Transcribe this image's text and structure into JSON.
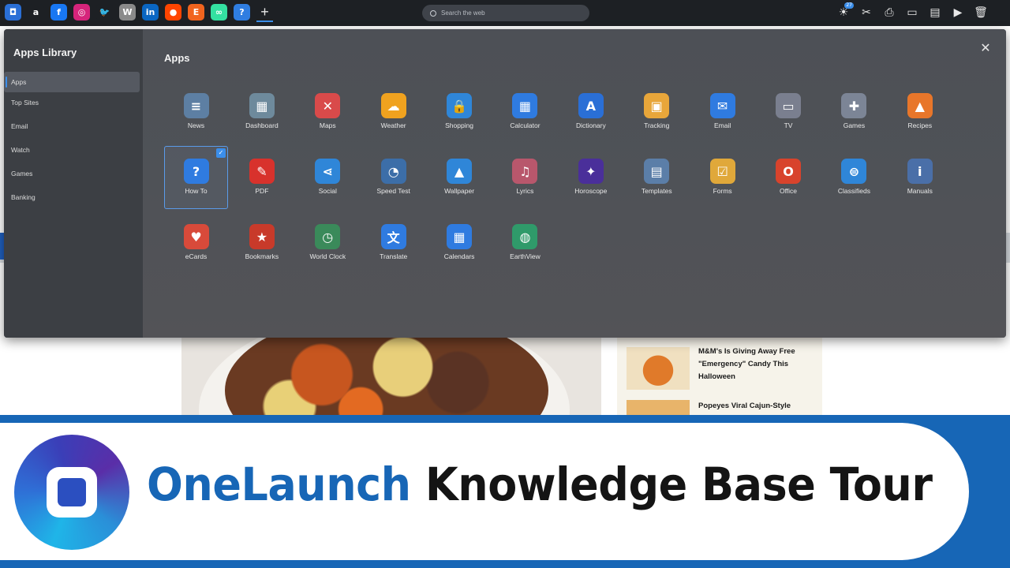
{
  "taskbar": {
    "favicons": [
      {
        "icon": "onelaunch-icon",
        "glyph": "◘",
        "color": "#2a6fd6"
      },
      {
        "icon": "amazon-icon",
        "glyph": "a",
        "color": "#1d2024"
      },
      {
        "icon": "facebook-icon",
        "glyph": "f",
        "color": "#1877f2"
      },
      {
        "icon": "instagram-icon",
        "glyph": "◎",
        "color": "#d6247b"
      },
      {
        "icon": "twitter-icon",
        "glyph": "🐦",
        "color": "#1d2024"
      },
      {
        "icon": "wikipedia-icon",
        "glyph": "W",
        "color": "#8a8a8a"
      },
      {
        "icon": "linkedin-icon",
        "glyph": "in",
        "color": "#0a66c2"
      },
      {
        "icon": "reddit-icon",
        "glyph": "●",
        "color": "#ff4500"
      },
      {
        "icon": "etsy-icon",
        "glyph": "E",
        "color": "#f1641e"
      },
      {
        "icon": "tripadvisor-icon",
        "glyph": "∞",
        "color": "#34e0a1"
      },
      {
        "icon": "help-icon",
        "glyph": "?",
        "color": "#2f7de1"
      }
    ],
    "new_tab": "+",
    "search_placeholder": "Search the web",
    "right_tools": [
      {
        "icon": "extensions-icon",
        "glyph": "☀",
        "badge": "27"
      },
      {
        "icon": "snip-icon",
        "glyph": "✂"
      },
      {
        "icon": "print-icon",
        "glyph": "⎙"
      },
      {
        "icon": "record-icon",
        "glyph": "▭"
      },
      {
        "icon": "notes-icon",
        "glyph": "▤"
      },
      {
        "icon": "play-icon",
        "glyph": "▶"
      },
      {
        "icon": "trash-icon",
        "glyph": "🗑"
      }
    ]
  },
  "background_page": {
    "news": [
      "M&M's Is Giving Away Free \"Emergency\" Candy This Halloween",
      "Popeyes Viral Cajun-Style"
    ]
  },
  "library": {
    "title": "Apps Library",
    "sidebar": [
      "Apps",
      "Top Sites",
      "Email",
      "Watch",
      "Games",
      "Banking"
    ],
    "active_index": 0,
    "section_title": "Apps",
    "close_glyph": "✕",
    "selected_app": "How To",
    "apps": [
      {
        "label": "News",
        "icon": "news-icon",
        "glyph": "≡",
        "color": "#5d7fa3"
      },
      {
        "label": "Dashboard",
        "icon": "dashboard-icon",
        "glyph": "▦",
        "color": "#6e8a9c"
      },
      {
        "label": "Maps",
        "icon": "maps-icon",
        "glyph": "✕",
        "color": "#d94a4a"
      },
      {
        "label": "Weather",
        "icon": "weather-icon",
        "glyph": "☁",
        "color": "#f0a21f"
      },
      {
        "label": "Shopping",
        "icon": "shopping-icon",
        "glyph": "🔒",
        "color": "#2f86d8"
      },
      {
        "label": "Calculator",
        "icon": "calculator-icon",
        "glyph": "▦",
        "color": "#2f7be0"
      },
      {
        "label": "Dictionary",
        "icon": "dictionary-icon",
        "glyph": "A",
        "color": "#2a6fd6"
      },
      {
        "label": "Tracking",
        "icon": "tracking-icon",
        "glyph": "▣",
        "color": "#e8a63a"
      },
      {
        "label": "Email",
        "icon": "email-icon",
        "glyph": "✉",
        "color": "#2f7be0"
      },
      {
        "label": "TV",
        "icon": "tv-icon",
        "glyph": "▭",
        "color": "#7a7f8f"
      },
      {
        "label": "Games",
        "icon": "games-icon",
        "glyph": "✚",
        "color": "#7c8596"
      },
      {
        "label": "Recipes",
        "icon": "recipes-icon",
        "glyph": "▲",
        "color": "#e8762a"
      },
      {
        "label": "How To",
        "icon": "how-to-icon",
        "glyph": "?",
        "color": "#2f7be0"
      },
      {
        "label": "PDF",
        "icon": "pdf-icon",
        "glyph": "✎",
        "color": "#d8322c"
      },
      {
        "label": "Social",
        "icon": "social-icon",
        "glyph": "⋖",
        "color": "#2f86d8"
      },
      {
        "label": "Speed Test",
        "icon": "speed-test-icon",
        "glyph": "◔",
        "color": "#3c6ea8"
      },
      {
        "label": "Wallpaper",
        "icon": "wallpaper-icon",
        "glyph": "▲",
        "color": "#2f86d8"
      },
      {
        "label": "Lyrics",
        "icon": "lyrics-icon",
        "glyph": "♫",
        "color": "#b8576c"
      },
      {
        "label": "Horoscope",
        "icon": "horoscope-icon",
        "glyph": "✦",
        "color": "#4a2f9a"
      },
      {
        "label": "Templates",
        "icon": "templates-icon",
        "glyph": "▤",
        "color": "#5b7ea8"
      },
      {
        "label": "Forms",
        "icon": "forms-icon",
        "glyph": "☑",
        "color": "#e0a83a"
      },
      {
        "label": "Office",
        "icon": "office-icon",
        "glyph": "O",
        "color": "#d8432c"
      },
      {
        "label": "Classifieds",
        "icon": "classifieds-icon",
        "glyph": "⊜",
        "color": "#2f86d8"
      },
      {
        "label": "Manuals",
        "icon": "manuals-icon",
        "glyph": "i",
        "color": "#4a6fa8"
      },
      {
        "label": "eCards",
        "icon": "ecards-icon",
        "glyph": "♥",
        "color": "#d84a3a"
      },
      {
        "label": "Bookmarks",
        "icon": "bookmarks-icon",
        "glyph": "★",
        "color": "#c83a2a"
      },
      {
        "label": "World Clock",
        "icon": "world-clock-icon",
        "glyph": "◷",
        "color": "#3a8a5a"
      },
      {
        "label": "Translate",
        "icon": "translate-icon",
        "glyph": "文",
        "color": "#2f7be0"
      },
      {
        "label": "Calendars",
        "icon": "calendars-icon",
        "glyph": "▦",
        "color": "#2f7be0"
      },
      {
        "label": "EarthView",
        "icon": "earthview-icon",
        "glyph": "◍",
        "color": "#2f9a6a"
      }
    ]
  },
  "banner": {
    "brand": "OneLaunch",
    "rest": " Knowledge Base Tour"
  },
  "colors": {
    "accent": "#3b8eea",
    "brand_blue": "#1766b6"
  }
}
